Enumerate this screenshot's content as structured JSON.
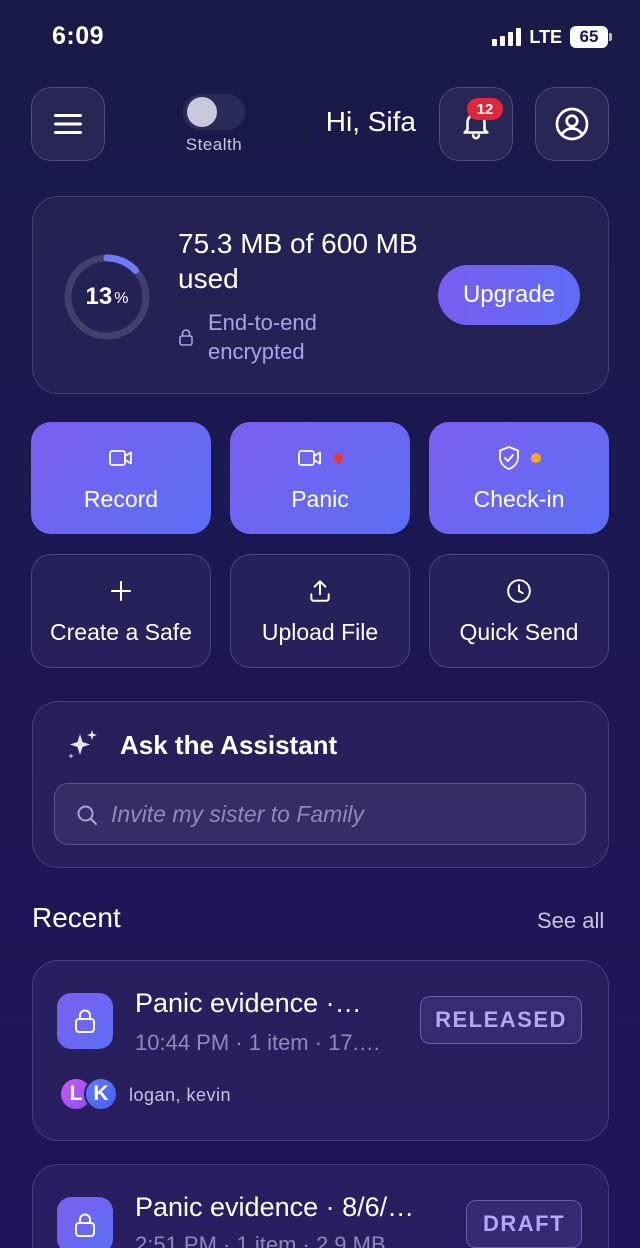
{
  "status_bar": {
    "time": "6:09",
    "network": "LTE",
    "battery": "65"
  },
  "header": {
    "menu_icon": "hamburger-icon",
    "stealth_label": "Stealth",
    "greeting": "Hi, Sifa",
    "notification_count": "12",
    "profile_icon": "user-icon"
  },
  "storage": {
    "percent": "13",
    "percent_sign": "%",
    "percent_value": 0.13,
    "usage": "75.3 MB of 600 MB used",
    "encryption": "End-to-end encrypted",
    "upgrade_label": "Upgrade"
  },
  "actions": {
    "record": "Record",
    "panic": "Panic",
    "checkin": "Check-in",
    "create_safe": "Create a Safe",
    "upload_file": "Upload File",
    "quick_send": "Quick Send"
  },
  "assistant": {
    "title": "Ask the Assistant",
    "placeholder": "Invite my sister to Family"
  },
  "recent": {
    "title": "Recent",
    "see_all": "See all",
    "items": [
      {
        "title": "Panic evidence ·…",
        "meta": "10:44 PM · 1 item · 17.…",
        "status": "RELEASED",
        "avatars": [
          "L",
          "K"
        ],
        "participants": "logan, kevin"
      },
      {
        "title": "Panic evidence · 8/6/…",
        "meta": "2:51 PM · 1 item · 2.9 MB",
        "status": "DRAFT"
      }
    ]
  },
  "colors": {
    "accent": "#6d65f3",
    "panic_dot": "#e53935",
    "checkin_dot": "#f5a623",
    "badge": "#e0283c"
  }
}
